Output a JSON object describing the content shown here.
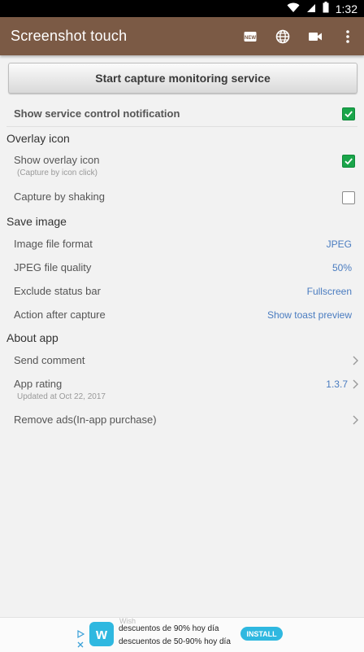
{
  "status_bar": {
    "time": "1:32"
  },
  "app_bar": {
    "title": "Screenshot touch"
  },
  "main": {
    "start_button": "Start capture monitoring service",
    "service_notification": {
      "label": "Show service control notification",
      "checked": true
    },
    "overlay_section": {
      "header": "Overlay icon",
      "show_overlay": {
        "label": "Show overlay icon",
        "sub": "(Capture by icon click)",
        "checked": true
      },
      "shake": {
        "label": "Capture by shaking",
        "checked": false
      }
    },
    "save_section": {
      "header": "Save image",
      "rows": [
        {
          "label": "Image file format",
          "value": "JPEG"
        },
        {
          "label": "JPEG file quality",
          "value": "50%"
        },
        {
          "label": "Exclude status bar",
          "value": "Fullscreen"
        },
        {
          "label": "Action after capture",
          "value": "Show toast preview"
        }
      ]
    },
    "about_section": {
      "header": "About app",
      "send_comment": "Send comment",
      "app_rating": {
        "label": "App rating",
        "sub": "Updated at Oct 22, 2017",
        "value": "1.3.7"
      },
      "remove_ads": "Remove ads(In-app purchase)"
    }
  },
  "ad": {
    "brand": "Wish",
    "line1": "descuentos de 90% hoy día",
    "line2": "descuentos de 50-90% hoy día",
    "install": "INSTALL",
    "logo_letter": "w"
  },
  "colors": {
    "app_bar": "#7b5a45",
    "checkbox_on": "#1aa54a",
    "value_text": "#4a7cc0",
    "ad_accent": "#2fb8e0"
  }
}
